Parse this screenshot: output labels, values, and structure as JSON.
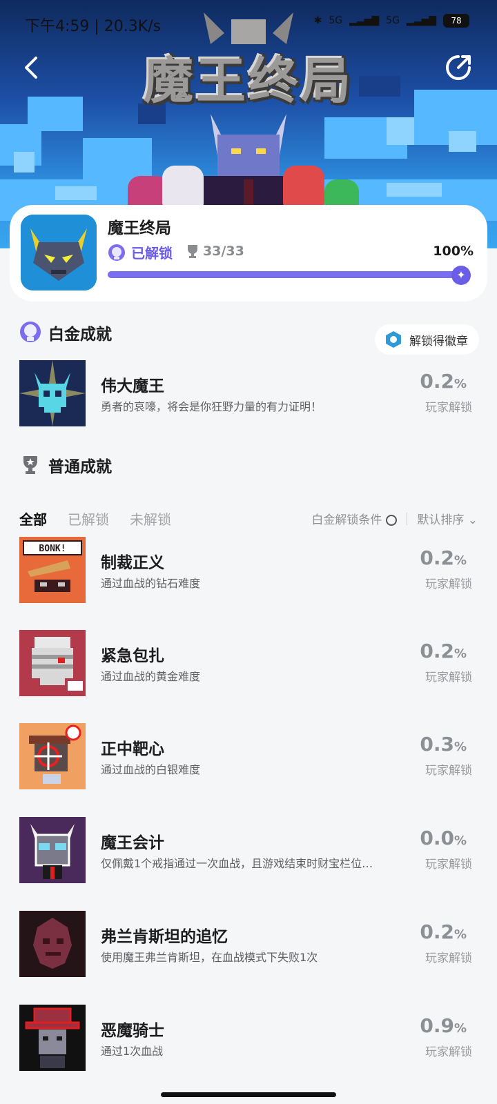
{
  "status_bar": {
    "time_speed": "下午4:59 | 20.3K/s",
    "battery": "78",
    "signal": "5G"
  },
  "hero": {
    "logo_text": "魔王终局"
  },
  "game": {
    "name": "魔王终局",
    "unlocked_label": "已解锁",
    "trophies": "33/33",
    "progress_percent": "100%",
    "progress_fraction": 1.0
  },
  "platinum_section": {
    "title": "白金成就",
    "badge_button": "解锁得徽章",
    "item": {
      "title": "伟大魔王",
      "desc": "勇者的哀嚎，将会是你狂野力量的有力证明！",
      "pct": "0.2",
      "unit": "%",
      "label": "玩家解锁"
    }
  },
  "normal_section": {
    "title": "普通成就",
    "tabs": [
      "全部",
      "已解锁",
      "未解锁"
    ],
    "condition_label": "白金解锁条件",
    "sort_label": "默认排序",
    "items": [
      {
        "title": "制裁正义",
        "desc": "通过血战的钻石难度",
        "pct": "0.2",
        "unit": "%",
        "label": "玩家解锁"
      },
      {
        "title": "紧急包扎",
        "desc": "通过血战的黄金难度",
        "pct": "0.2",
        "unit": "%",
        "label": "玩家解锁"
      },
      {
        "title": "正中靶心",
        "desc": "通过血战的白银难度",
        "pct": "0.3",
        "unit": "%",
        "label": "玩家解锁"
      },
      {
        "title": "魔王会计",
        "desc": "仅佩戴1个戒指通过一次血战，且游戏结束时财宝栏位…",
        "pct": "0.0",
        "unit": "%",
        "label": "玩家解锁"
      },
      {
        "title": "弗兰肯斯坦的追忆",
        "desc": "使用魔王弗兰肯斯坦，在血战模式下失败1次",
        "pct": "0.2",
        "unit": "%",
        "label": "玩家解锁"
      },
      {
        "title": "恶魔骑士",
        "desc": "通过1次血战",
        "pct": "0.9",
        "unit": "%",
        "label": "玩家解锁"
      }
    ]
  },
  "thumb_text": {
    "bonk": "BONK!"
  },
  "colors": {
    "accent": "#6a5de6",
    "progress": "#7b6df0",
    "background": "#f5f6f8"
  }
}
